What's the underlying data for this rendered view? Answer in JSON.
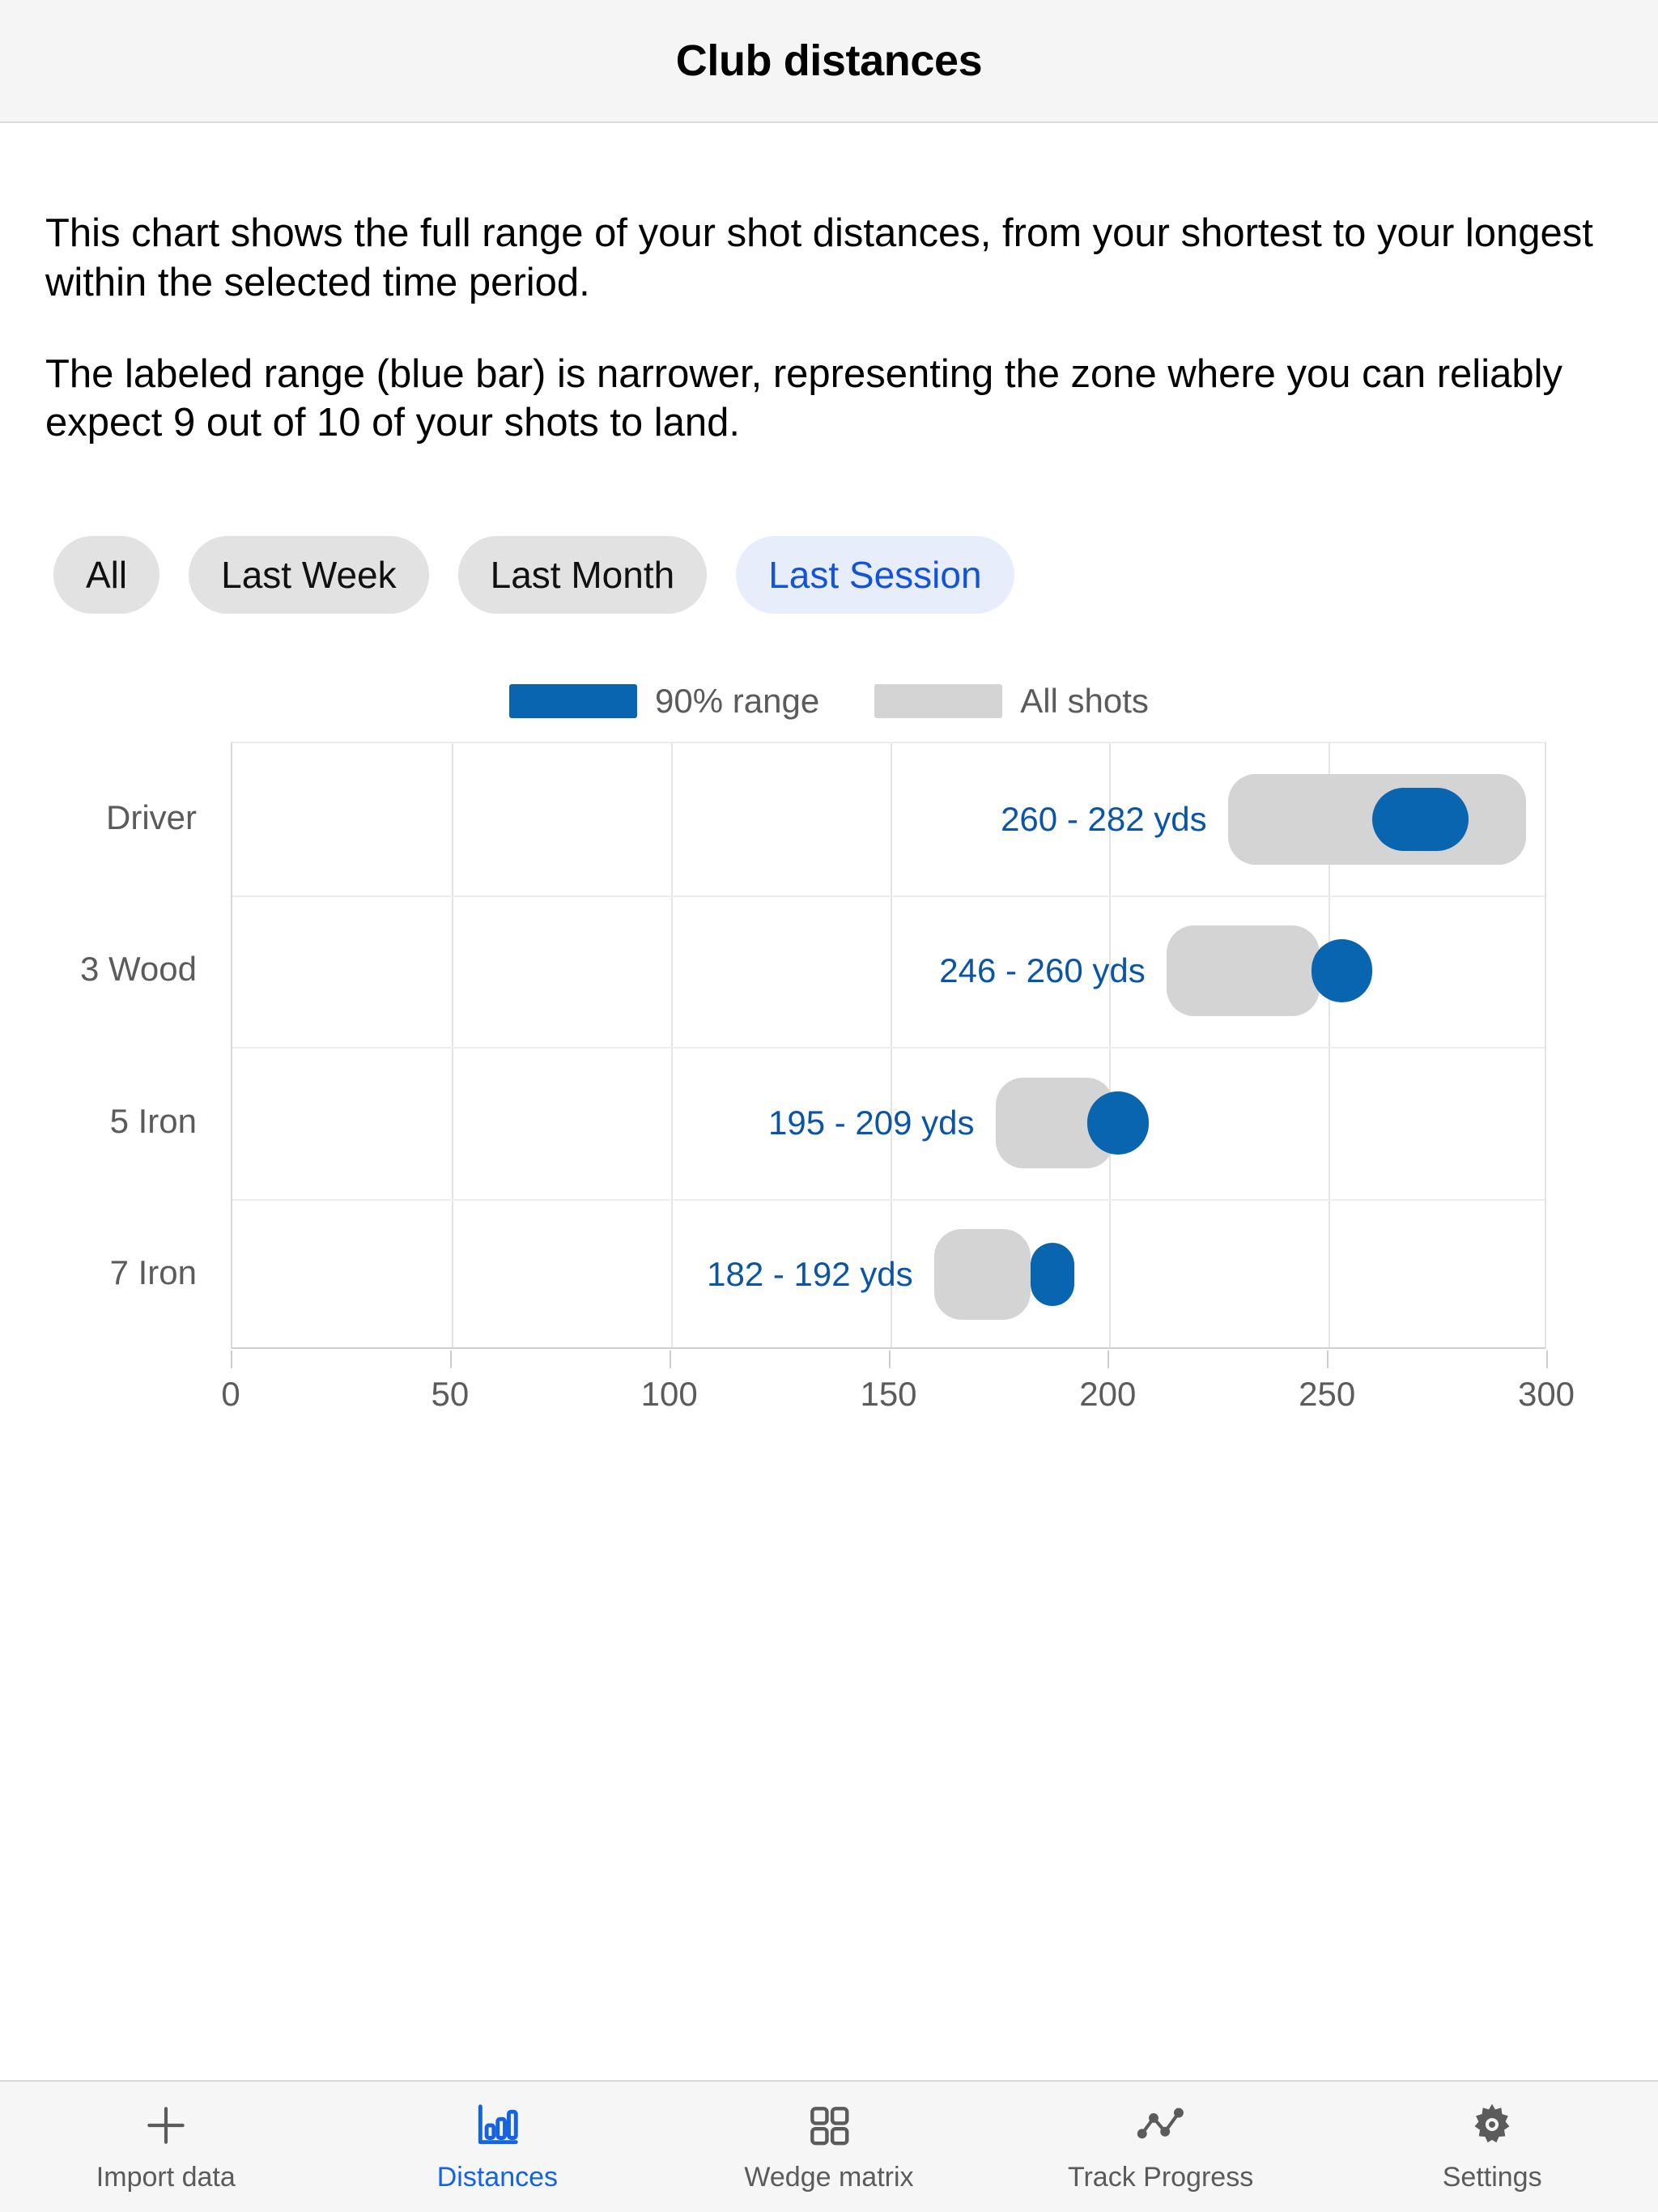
{
  "header": {
    "title": "Club distances"
  },
  "intro": {
    "paragraph1": "This chart shows the full range of your shot distances, from your shortest to your longest within the selected time period.",
    "paragraph2": "The labeled range (blue bar) is narrower, representing the zone where you can reliably expect 9 out of 10 of your shots to land."
  },
  "filters": {
    "options": [
      {
        "label": "All",
        "selected": false
      },
      {
        "label": "Last Week",
        "selected": false
      },
      {
        "label": "Last Month",
        "selected": false
      },
      {
        "label": "Last Session",
        "selected": true
      }
    ],
    "selected": "Last Session"
  },
  "legend": {
    "items": [
      {
        "label": "90% range",
        "color": "#0a65b0"
      },
      {
        "label": "All shots",
        "color": "#d4d4d4"
      }
    ]
  },
  "chart_data": {
    "type": "bar",
    "title": "Club distances",
    "xlabel": "",
    "ylabel": "",
    "xlim": [
      0,
      300
    ],
    "grid": true,
    "legend_position": "top-center",
    "xticks": [
      0,
      50,
      100,
      150,
      200,
      250,
      300
    ],
    "xtick_labels": [
      "0",
      "50",
      "100",
      "150",
      "200",
      "250",
      "300"
    ],
    "categories": [
      "Driver",
      "3 Wood",
      "5 Iron",
      "7 Iron"
    ],
    "series": [
      {
        "name": "All shots",
        "color": "#d4d4d4",
        "ranges": [
          {
            "category": "Driver",
            "min": 227,
            "max": 295
          },
          {
            "category": "3 Wood",
            "min": 213,
            "max": 248
          },
          {
            "category": "5 Iron",
            "min": 174,
            "max": 201
          },
          {
            "category": "7 Iron",
            "min": 160,
            "max": 182
          }
        ]
      },
      {
        "name": "90% range",
        "color": "#0a65b0",
        "ranges": [
          {
            "category": "Driver",
            "min": 260,
            "max": 282
          },
          {
            "category": "3 Wood",
            "min": 246,
            "max": 260
          },
          {
            "category": "5 Iron",
            "min": 195,
            "max": 209
          },
          {
            "category": "7 Iron",
            "min": 182,
            "max": 192
          }
        ]
      }
    ],
    "data_labels": [
      {
        "category": "Driver",
        "text": "260 - 282 yds"
      },
      {
        "category": "3 Wood",
        "text": "246 - 260 yds"
      },
      {
        "category": "5 Iron",
        "text": "195 - 209 yds"
      },
      {
        "category": "7 Iron",
        "text": "182 - 192 yds"
      }
    ],
    "unit": "yds"
  },
  "tabbar": {
    "items": [
      {
        "label": "Import data",
        "icon": "plus-icon",
        "active": false
      },
      {
        "label": "Distances",
        "icon": "bar-chart-icon",
        "active": true
      },
      {
        "label": "Wedge matrix",
        "icon": "grid-icon",
        "active": false
      },
      {
        "label": "Track Progress",
        "icon": "line-chart-icon",
        "active": false
      },
      {
        "label": "Settings",
        "icon": "gear-icon",
        "active": false
      }
    ],
    "active_color": "#1463e0",
    "inactive_color": "#5b5b5b"
  }
}
